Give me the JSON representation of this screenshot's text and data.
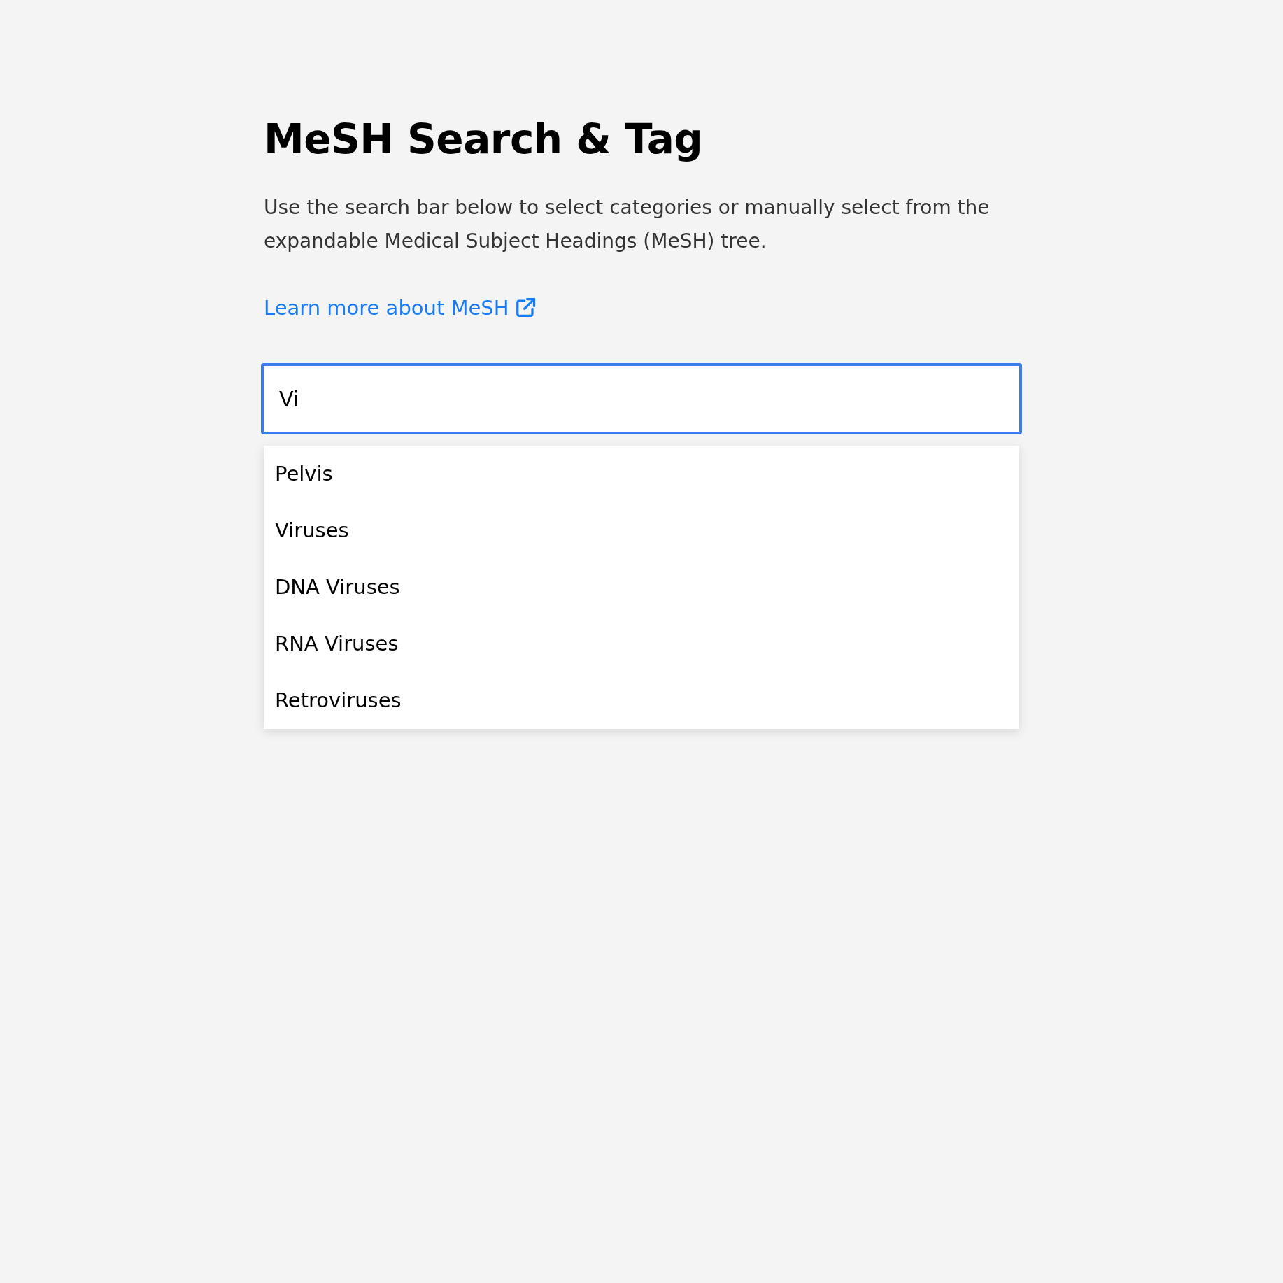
{
  "title": "MeSH Search & Tag",
  "description": "Use the search bar below to select categories or manually select from the expandable Medical Subject Headings (MeSH) tree.",
  "link": {
    "label": "Learn more about MeSH"
  },
  "search": {
    "value": "Vi",
    "focused": true
  },
  "suggestions": [
    {
      "label": "Pelvis"
    },
    {
      "label": "Viruses"
    },
    {
      "label": "DNA Viruses"
    },
    {
      "label": "RNA Viruses"
    },
    {
      "label": "Retroviruses"
    }
  ]
}
